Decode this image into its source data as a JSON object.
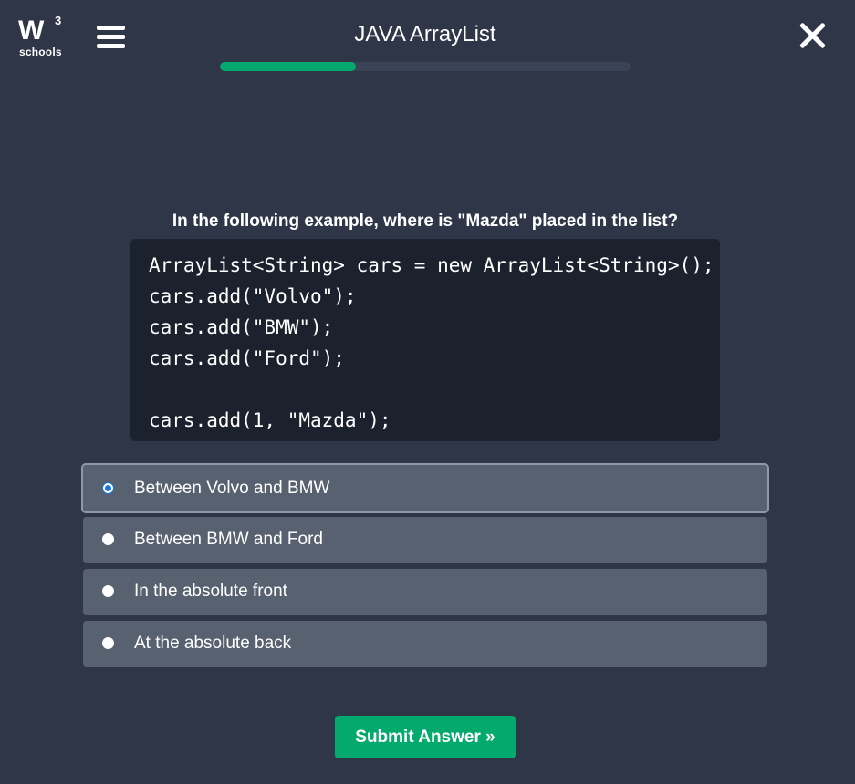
{
  "header": {
    "logo_mark": "W",
    "logo_superscript": "3",
    "logo_text": "schools",
    "title": "JAVA ArrayList",
    "progress_fraction": 0.33
  },
  "question": {
    "text": "In the following example, where is \"Mazda\" placed in the list?",
    "code_lines": [
      "ArrayList<String> cars = new ArrayList<String>();",
      "cars.add(\"Volvo\");",
      "cars.add(\"BMW\");",
      "cars.add(\"Ford\");",
      "",
      "cars.add(1, \"Mazda\");"
    ]
  },
  "options": [
    {
      "label": "Between Volvo and BMW",
      "selected": true
    },
    {
      "label": "Between BMW and Ford",
      "selected": false
    },
    {
      "label": "In the absolute front",
      "selected": false
    },
    {
      "label": "At the absolute back",
      "selected": false
    }
  ],
  "submit": {
    "label": "Submit Answer »"
  },
  "colors": {
    "background": "#2e3648",
    "accent": "#04aa6d",
    "code_background": "#1b222d",
    "option_background": "#576170",
    "radio_selected": "#1a73e8"
  },
  "icons": {
    "menu": "hamburger-icon",
    "close": "close-icon"
  }
}
